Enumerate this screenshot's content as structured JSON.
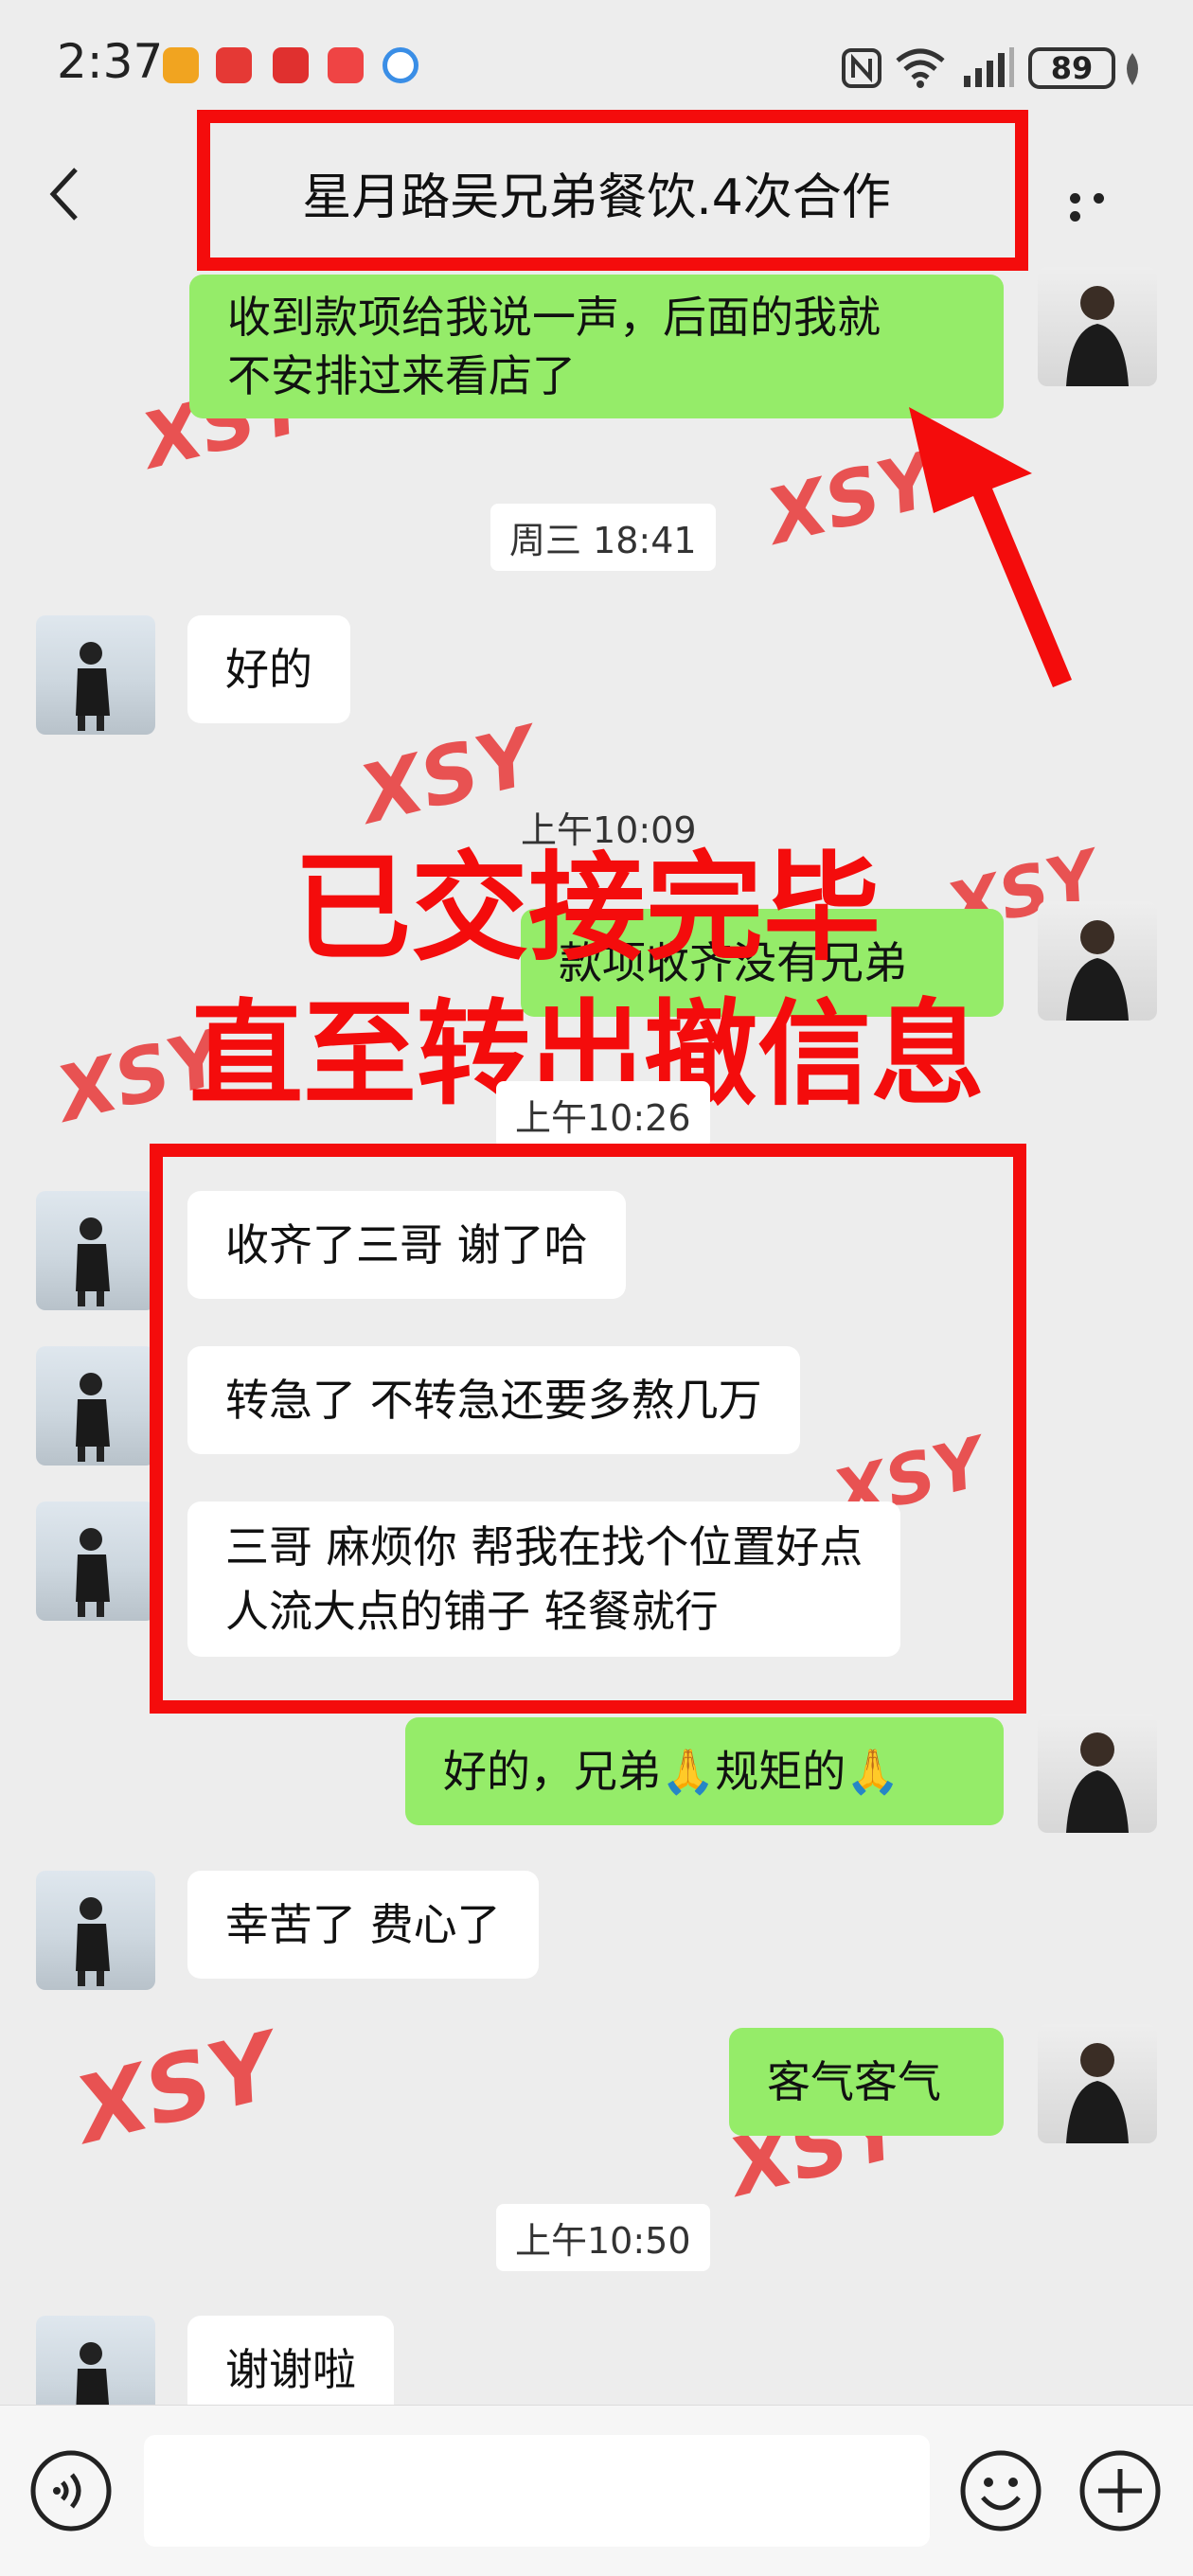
{
  "status_bar": {
    "time": "2:37",
    "battery": "89",
    "app_icon_colors": [
      "#e23b3b",
      "#ef3b3b",
      "#e0302f",
      "#e84040",
      "#3a8ee6"
    ]
  },
  "header": {
    "title": "星月路吴兄弟餐饮.4次合作"
  },
  "messages": {
    "m1": {
      "line1": "收到款项给我说一声，后面的我就",
      "line2": "不安排过来看店了"
    },
    "ts1": "周三 18:41",
    "m2": "好的",
    "ts2": "上午10:09",
    "m3": "款项收齐没有兄弟",
    "ts3": "上午10:26",
    "m4": "收齐了三哥 谢了哈",
    "m5": "转急了 不转急还要多熬几万",
    "m6": {
      "line1": "三哥 麻烦你 帮我在找个位置好点",
      "line2": "人流大点的铺子 轻餐就行"
    },
    "m7": "好的，兄弟🙏规矩的🙏",
    "m8": "幸苦了 费心了",
    "m9": "客气客气",
    "ts4": "上午10:50",
    "m10": "谢谢啦"
  },
  "overlay": {
    "line1": "已交接完毕",
    "line2": "直至转出撤信息",
    "watermark": "XSY"
  },
  "colors": {
    "annotation_red": "#f40c0c",
    "outgoing_bubble": "#95ec69",
    "incoming_bubble": "#ffffff",
    "background": "#ededed"
  },
  "icons": {
    "back": "chevron-left-icon",
    "more": "more-dots-icon",
    "voice": "voice-icon",
    "emoji": "emoji-icon",
    "add": "plus-icon"
  }
}
